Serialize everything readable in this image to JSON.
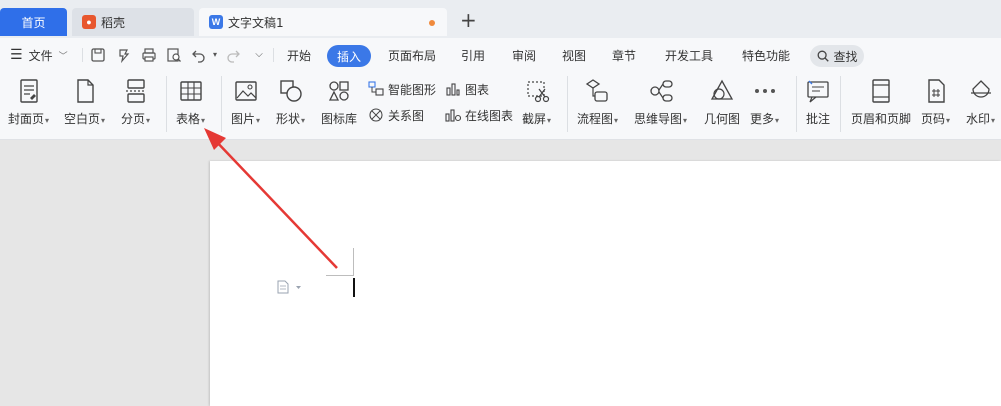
{
  "tabs": {
    "home": "首页",
    "daoke": "稻壳",
    "doc": "文字文稿1",
    "add": "+"
  },
  "menubar": {
    "file": "文件",
    "items": [
      "开始",
      "插入",
      "页面布局",
      "引用",
      "审阅",
      "视图",
      "章节",
      "开发工具",
      "特色功能"
    ],
    "active": "插入",
    "search": "查找"
  },
  "ribbon": {
    "cover": "封面页",
    "blank": "空白页",
    "pagebreak": "分页",
    "table": "表格",
    "picture": "图片",
    "shape": "形状",
    "iconlib": "图标库",
    "smartart": "智能图形",
    "relation": "关系图",
    "chart": "图表",
    "onlinechart": "在线图表",
    "screenshot": "截屏",
    "flowchart": "流程图",
    "mindmap": "思维导图",
    "geometry": "几何图",
    "more": "更多",
    "comment": "批注",
    "headerfooter": "页眉和页脚",
    "pagenum": "页码",
    "watermark": "水印"
  },
  "colors": {
    "accent": "#3b78e7",
    "home_tab": "#2f6fe9",
    "annotation_arrow": "#e53935"
  }
}
